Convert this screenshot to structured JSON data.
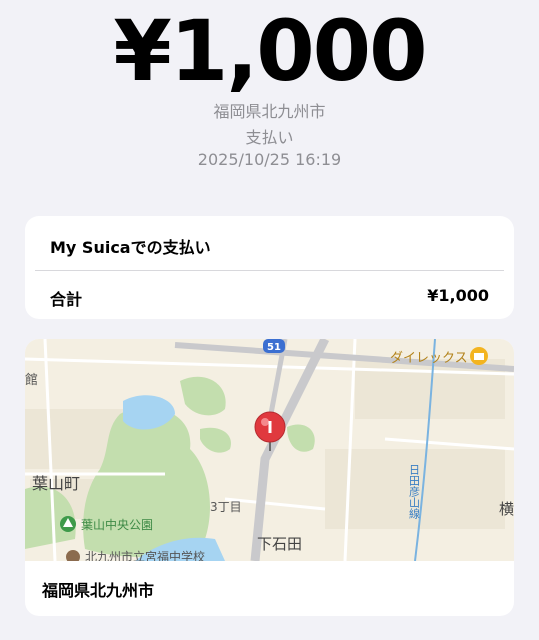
{
  "amount": "¥1,000",
  "location": "福岡県北九州市",
  "type": "支払い",
  "datetime": "2025/10/25 16:19",
  "details": {
    "title": "My Suicaでの支払い",
    "total_label": "合計",
    "total_value": "¥1,000"
  },
  "map": {
    "labels": {
      "route": "51",
      "store": "ダイレックス",
      "kan": "館",
      "hayama": "葉山町",
      "park": "葉山中央公園",
      "chome": "3丁目",
      "shimoishida": "下石田",
      "line": "日田彦山線",
      "yoko": "横",
      "bottom": "北九州市立宮福中学校"
    },
    "colors": {
      "land": "#f4efe2",
      "green": "#c3deae",
      "water": "#a6d4f2",
      "road": "#c9c9cc",
      "pin": "#e0393e"
    }
  },
  "location_footer": "福岡県北九州市"
}
